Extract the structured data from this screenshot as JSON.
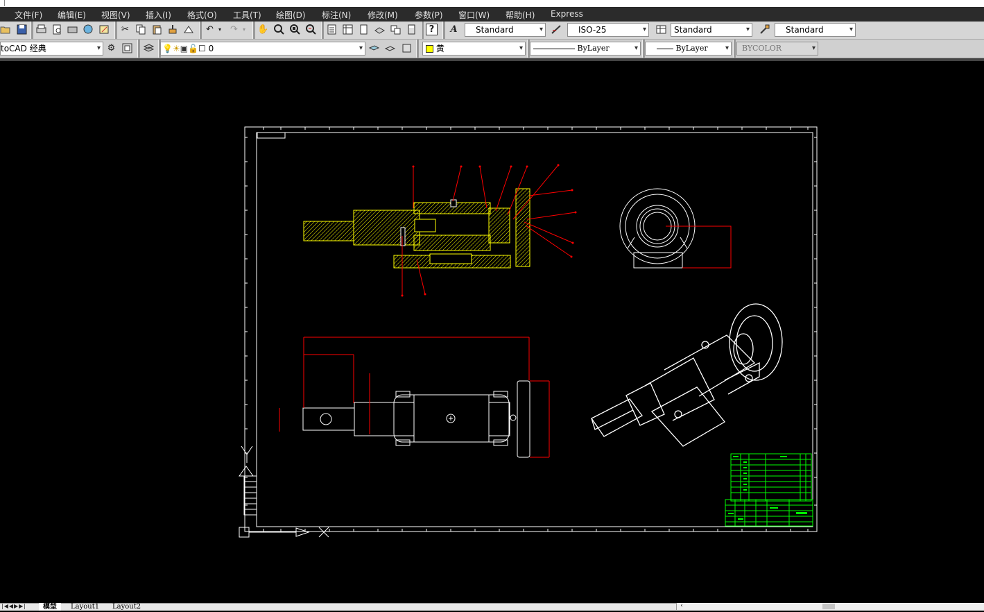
{
  "menu": [
    "文件(F)",
    "编辑(E)",
    "视图(V)",
    "插入(I)",
    "格式(O)",
    "工具(T)",
    "绘图(D)",
    "标注(N)",
    "修改(M)",
    "参数(P)",
    "窗口(W)",
    "帮助(H)",
    "Express"
  ],
  "styles": {
    "text_style": "Standard",
    "dim_style": "ISO-25",
    "table_style": "Standard",
    "multileader_style": "Standard"
  },
  "workspace": "toCAD 经典",
  "layer": {
    "name": "0"
  },
  "color": {
    "name": "黄",
    "swatch": "#ffff00"
  },
  "linetype": "ByLayer",
  "lineweight": "ByLayer",
  "plotstyle": "BYCOLOR",
  "tabs": [
    "模型",
    "Layout1",
    "Layout2"
  ],
  "colors": {
    "canvas": "#000000",
    "frame": "#ffffff",
    "part": "#ffff00",
    "dimension": "#ff0000",
    "titleblock": "#00ff00"
  }
}
